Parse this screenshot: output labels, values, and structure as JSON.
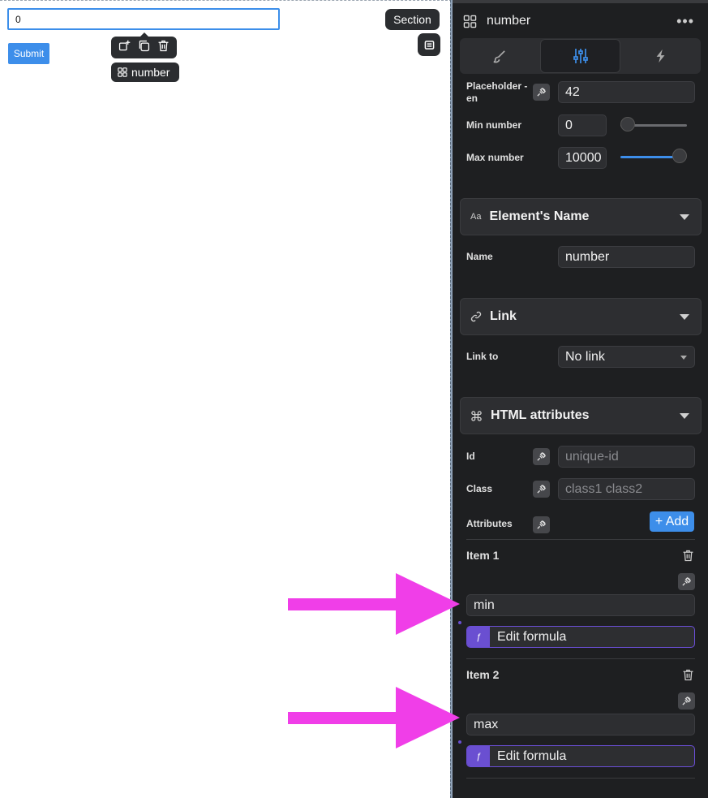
{
  "canvas": {
    "number_input_value": "0",
    "submit_label": "Submit",
    "element_tag": "number",
    "section_label": "Section"
  },
  "panel": {
    "title": "number",
    "more": "•••",
    "tabs": [
      "style",
      "settings",
      "interactions"
    ],
    "placeholder_label": "Placeholder - en",
    "placeholder_value": "42",
    "min_label": "Min number",
    "min_value": "0",
    "max_label": "Max number",
    "max_value": "10000",
    "min_slider_fraction": 0.0,
    "max_slider_fraction": 1.0,
    "sections": {
      "element_name": {
        "title": "Element's Name",
        "icon_text": "Aa",
        "name_label": "Name",
        "name_value": "number"
      },
      "link": {
        "title": "Link",
        "link_to_label": "Link to",
        "link_to_value": "No link"
      },
      "html_attributes": {
        "title": "HTML attributes",
        "id_label": "Id",
        "id_placeholder": "unique-id",
        "class_label": "Class",
        "class_placeholder": "class1 class2",
        "attributes_label": "Attributes",
        "add_label": "+ Add",
        "items": [
          {
            "label": "Item 1",
            "value": "min",
            "formula_label": "Edit formula",
            "formula_icon": "ƒ"
          },
          {
            "label": "Item 2",
            "value": "max",
            "formula_label": "Edit formula",
            "formula_icon": "ƒ"
          }
        ]
      }
    }
  },
  "colors": {
    "accent_blue": "#3d8eea",
    "panel_bg": "#1e1f21",
    "formula_purple": "#6a4fd1",
    "arrow_magenta": "#f03ee8"
  }
}
